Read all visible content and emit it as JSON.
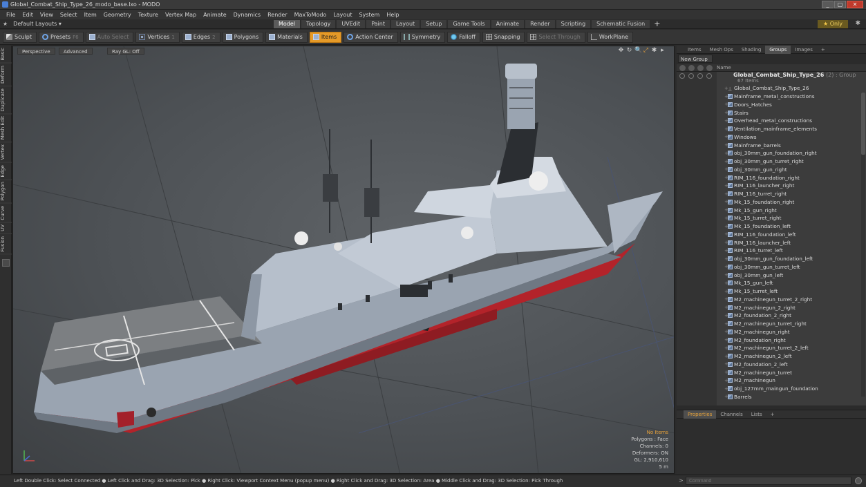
{
  "window": {
    "title": "Global_Combat_Ship_Type_26_modo_base.lxo - MODO",
    "min_label": "_",
    "max_label": "▢",
    "close_label": "✕"
  },
  "menu": [
    "File",
    "Edit",
    "View",
    "Select",
    "Item",
    "Geometry",
    "Texture",
    "Vertex Map",
    "Animate",
    "Dynamics",
    "Render",
    "MaxToModo",
    "Layout",
    "System",
    "Help"
  ],
  "layout": {
    "dropdown": "Default Layouts ▾",
    "star": "★",
    "tabs": [
      "Model",
      "Topology",
      "UVEdit",
      "Paint",
      "Layout",
      "Setup",
      "Game Tools",
      "Animate",
      "Render",
      "Scripting",
      "Schematic Fusion"
    ],
    "active_tab": "Model",
    "add_tab": "+",
    "only_label": "Only",
    "only_star": "★",
    "gear": "✱"
  },
  "toolbar": {
    "sculpt": "Sculpt",
    "presets": "Presets",
    "presets_hint": "F6",
    "auto_select": "Auto Select",
    "vertices": "Vertices",
    "vertices_hint": "1",
    "edges": "Edges",
    "edges_hint": "2",
    "polygons": "Polygons",
    "materials": "Materials",
    "items": "Items",
    "action_center": "Action Center",
    "symmetry": "Symmetry",
    "falloff": "Falloff",
    "snapping": "Snapping",
    "select_through": "Select Through",
    "workplane": "WorkPlane"
  },
  "left_tabs": [
    "Basic",
    "Deform",
    "Duplicate",
    "Mesh Edit",
    "Vertex",
    "Edge",
    "Polygon",
    "Curve",
    "UV",
    "Fusion"
  ],
  "viewport": {
    "view_mode": "Perspective",
    "shading": "Advanced",
    "raygl": "Ray GL: Off",
    "nav_icons": [
      "✥",
      "↻",
      "🔍",
      "⤢",
      "✱",
      "▸"
    ],
    "info": {
      "selection": "No Items",
      "polygons": "Polygons : Face",
      "channels": "Channels: 0",
      "deformers": "Deformers: ON",
      "gl": "GL: 2,910,610",
      "scale": "5 m"
    }
  },
  "right_panel": {
    "tabs": [
      "Items",
      "Mesh Ops",
      "Shading",
      "Groups",
      "Images",
      "+"
    ],
    "active_tab": "Groups",
    "new_group": "New Group",
    "column_name": "Name",
    "group": {
      "name": "Global_Combat_Ship_Type_26",
      "count_label": "(2) : Group",
      "items_label": "67 Items"
    },
    "items": [
      {
        "name": "Global_Combat_Ship_Type_26",
        "kind": "locator"
      },
      {
        "name": "Mainframe_metal_constructions",
        "kind": "mesh"
      },
      {
        "name": "Doors_Hatches",
        "kind": "mesh"
      },
      {
        "name": "Stairs",
        "kind": "mesh"
      },
      {
        "name": "Overhead_metal_constructions",
        "kind": "mesh"
      },
      {
        "name": "Ventilation_mainframe_elements",
        "kind": "mesh"
      },
      {
        "name": "Windows",
        "kind": "mesh"
      },
      {
        "name": "Mainframe_barrels",
        "kind": "mesh"
      },
      {
        "name": "obj_30mm_gun_foundation_right",
        "kind": "mesh"
      },
      {
        "name": "obj_30mm_gun_turret_right",
        "kind": "mesh"
      },
      {
        "name": "obj_30mm_gun_right",
        "kind": "mesh"
      },
      {
        "name": "RIM_116_foundation_right",
        "kind": "mesh"
      },
      {
        "name": "RIM_116_launcher_right",
        "kind": "mesh"
      },
      {
        "name": "RIM_116_turret_right",
        "kind": "mesh"
      },
      {
        "name": "Mk_15_foundation_right",
        "kind": "mesh"
      },
      {
        "name": "Mk_15_gun_right",
        "kind": "mesh"
      },
      {
        "name": "Mk_15_turret_right",
        "kind": "mesh"
      },
      {
        "name": "Mk_15_foundation_left",
        "kind": "mesh"
      },
      {
        "name": "RIM_116_foundation_left",
        "kind": "mesh"
      },
      {
        "name": "RIM_116_launcher_left",
        "kind": "mesh"
      },
      {
        "name": "RIM_116_turret_left",
        "kind": "mesh"
      },
      {
        "name": "obj_30mm_gun_foundation_left",
        "kind": "mesh"
      },
      {
        "name": "obj_30mm_gun_turret_left",
        "kind": "mesh"
      },
      {
        "name": "obj_30mm_gun_left",
        "kind": "mesh"
      },
      {
        "name": "Mk_15_gun_left",
        "kind": "mesh"
      },
      {
        "name": "Mk_15_turret_left",
        "kind": "mesh"
      },
      {
        "name": "M2_machinegun_turret_2_right",
        "kind": "mesh"
      },
      {
        "name": "M2_machinegun_2_right",
        "kind": "mesh"
      },
      {
        "name": "M2_foundation_2_right",
        "kind": "mesh"
      },
      {
        "name": "M2_machinegun_turret_right",
        "kind": "mesh"
      },
      {
        "name": "M2_machinegun_right",
        "kind": "mesh"
      },
      {
        "name": "M2_foundation_right",
        "kind": "mesh"
      },
      {
        "name": "M2_machinegun_turret_2_left",
        "kind": "mesh"
      },
      {
        "name": "M2_machinegun_2_left",
        "kind": "mesh"
      },
      {
        "name": "M2_foundation_2_left",
        "kind": "mesh"
      },
      {
        "name": "M2_machinegun_turret",
        "kind": "mesh"
      },
      {
        "name": "M2_machinegun",
        "kind": "mesh"
      },
      {
        "name": "obj_127mm_maingun_foundation",
        "kind": "mesh"
      },
      {
        "name": "Barrels",
        "kind": "mesh"
      }
    ],
    "props_tabs": [
      "Properties",
      "Channels",
      "Lists",
      "+"
    ],
    "props_active": "Properties"
  },
  "statusbar": {
    "hints": "Left Double Click: Select Connected ● Left Click and Drag: 3D Selection: Pick ● Right Click: Viewport Context Menu (popup menu) ● Right Click and Drag: 3D Selection: Area ● Middle Click and Drag: 3D Selection: Pick Through",
    "command_placeholder": "Command",
    "command_arrow": ">"
  },
  "colors": {
    "accent": "#e59a28",
    "hull": "#a9b3c0",
    "bottom_paint": "#b3232a",
    "deck": "#7c7f82"
  }
}
